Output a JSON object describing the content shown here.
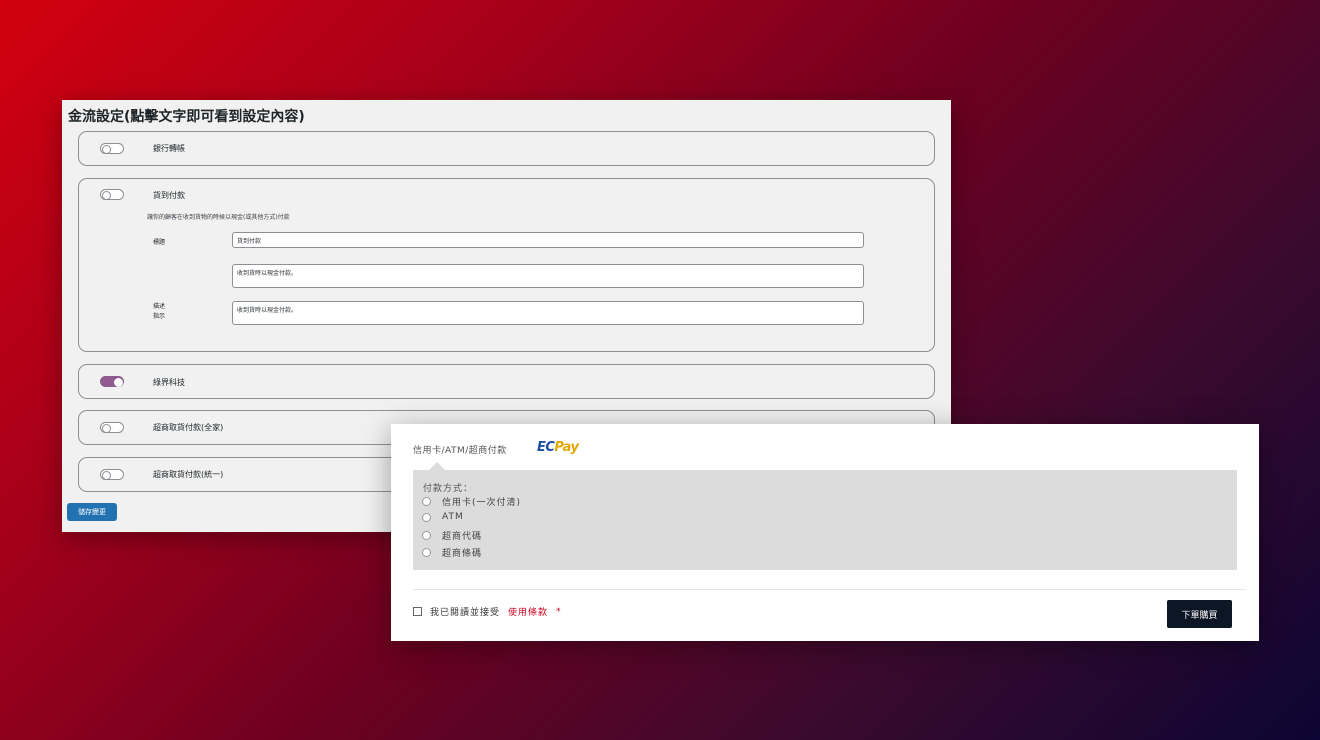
{
  "admin": {
    "title": "金流設定(點擊文字即可看到設定內容)",
    "methods": [
      {
        "name": "銀行轉帳",
        "enabled": false
      },
      {
        "name": "貨到付款",
        "enabled": false,
        "description": "讓你的顧客在收到貨物的時候以現金(或其他方式)付款",
        "fields": [
          {
            "label": "標題",
            "value": "貨到付款"
          },
          {
            "label": "描述",
            "value": "收到貨時以現金付款。"
          },
          {
            "label": "指示",
            "value": "收到貨時以現金付款。"
          }
        ]
      },
      {
        "name": "綠界科技",
        "enabled": true
      },
      {
        "name": "超商取貨付款(全家)",
        "enabled": false
      },
      {
        "name": "超商取貨付款(統一)",
        "enabled": false
      }
    ],
    "save_label": "儲存變更",
    "toggle_on_color": "#8e5a8f",
    "save_color": "#2271b1"
  },
  "checkout": {
    "method_title": "信用卡/ATM/超商付款",
    "logo": {
      "ec": "EC",
      "pay": "Pay"
    },
    "pm_label": "付款方式：",
    "options": [
      "信用卡(一次付清)",
      "ATM",
      "超商代碼",
      "超商條碼"
    ],
    "terms_prefix": "我已閱讀並接受",
    "terms_link": "使用條款",
    "required_mark": "*",
    "order_button": "下單購買",
    "order_button_color": "#0d1625"
  }
}
